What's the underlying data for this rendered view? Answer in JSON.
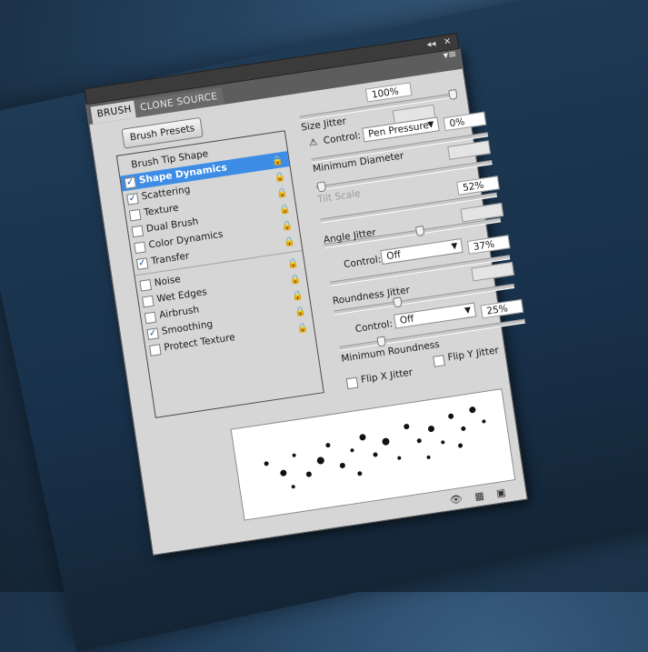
{
  "window": {
    "collapse_label": "◂◂",
    "close_label": "✕",
    "menu_label": "▾≡"
  },
  "tabs": [
    {
      "label": "BRUSH"
    },
    {
      "label": "CLONE SOURCE"
    }
  ],
  "brush_presets_label": "Brush Presets",
  "list": {
    "header": "Brush Tip Shape",
    "items": [
      {
        "label": "Shape Dynamics",
        "checked": true,
        "selected": true
      },
      {
        "label": "Scattering",
        "checked": true
      },
      {
        "label": "Texture",
        "checked": false
      },
      {
        "label": "Dual Brush",
        "checked": false
      },
      {
        "label": "Color Dynamics",
        "checked": false
      },
      {
        "label": "Transfer",
        "checked": true
      },
      {
        "label": "Noise",
        "checked": false
      },
      {
        "label": "Wet Edges",
        "checked": false
      },
      {
        "label": "Airbrush",
        "checked": false
      },
      {
        "label": "Smoothing",
        "checked": true
      },
      {
        "label": "Protect Texture",
        "checked": false
      }
    ]
  },
  "settings": {
    "size_jitter_label": "Size Jitter",
    "size_jitter_value": "100%",
    "control_label": "Control:",
    "control1_value": "Pen Pressure",
    "min_diameter_label": "Minimum Diameter",
    "min_diameter_value": "0%",
    "tilt_scale_label": "Tilt Scale",
    "angle_jitter_label": "Angle Jitter",
    "angle_jitter_value": "52%",
    "control2_value": "Off",
    "roundness_jitter_label": "Roundness Jitter",
    "roundness_jitter_value": "37%",
    "control3_value": "Off",
    "min_roundness_label": "Minimum Roundness",
    "min_roundness_value": "25%",
    "flip_x_label": "Flip X Jitter",
    "flip_y_label": "Flip Y Jitter"
  },
  "icons": {
    "warning": "warning-icon",
    "lock": "lock-icon",
    "eye": "eye-brush-icon",
    "grid": "grid-icon",
    "new": "new-preset-icon"
  }
}
